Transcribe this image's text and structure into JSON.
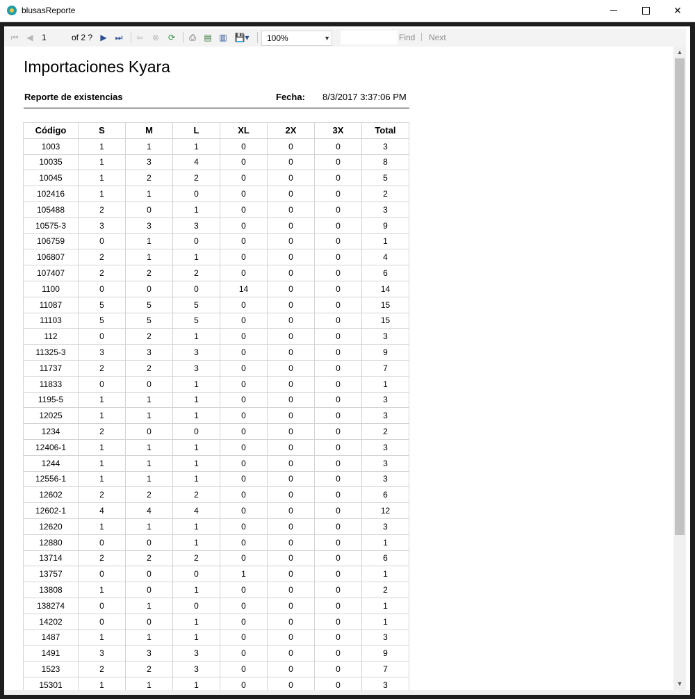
{
  "window": {
    "title": "blusasReporte",
    "minimize": "—",
    "maximize": "☐",
    "close": "✕"
  },
  "toolbar": {
    "page_value": "1",
    "page_of": "of  2 ?",
    "zoom": "100%",
    "find_placeholder": "",
    "find_label": "Find",
    "next_label": "Next",
    "icons": [
      "first-page",
      "previous-page",
      "next-page",
      "last-page",
      "back",
      "stop",
      "refresh",
      "print",
      "print-layout",
      "page-setup",
      "export"
    ]
  },
  "report": {
    "title": "Importaciones Kyara",
    "subtitle": "Reporte de existencias",
    "fecha_label": "Fecha:",
    "fecha": "8/3/2017 3:37:06 PM",
    "columns": [
      "Código",
      "S",
      "M",
      "L",
      "XL",
      "2X",
      "3X",
      "Total"
    ],
    "rows": [
      [
        "1003",
        "1",
        "1",
        "1",
        "0",
        "0",
        "0",
        "3"
      ],
      [
        "10035",
        "1",
        "3",
        "4",
        "0",
        "0",
        "0",
        "8"
      ],
      [
        "10045",
        "1",
        "2",
        "2",
        "0",
        "0",
        "0",
        "5"
      ],
      [
        "102416",
        "1",
        "1",
        "0",
        "0",
        "0",
        "0",
        "2"
      ],
      [
        "105488",
        "2",
        "0",
        "1",
        "0",
        "0",
        "0",
        "3"
      ],
      [
        "10575-3",
        "3",
        "3",
        "3",
        "0",
        "0",
        "0",
        "9"
      ],
      [
        "106759",
        "0",
        "1",
        "0",
        "0",
        "0",
        "0",
        "1"
      ],
      [
        "106807",
        "2",
        "1",
        "1",
        "0",
        "0",
        "0",
        "4"
      ],
      [
        "107407",
        "2",
        "2",
        "2",
        "0",
        "0",
        "0",
        "6"
      ],
      [
        "1100",
        "0",
        "0",
        "0",
        "14",
        "0",
        "0",
        "14"
      ],
      [
        "11087",
        "5",
        "5",
        "5",
        "0",
        "0",
        "0",
        "15"
      ],
      [
        "11103",
        "5",
        "5",
        "5",
        "0",
        "0",
        "0",
        "15"
      ],
      [
        "112",
        "0",
        "2",
        "1",
        "0",
        "0",
        "0",
        "3"
      ],
      [
        "11325-3",
        "3",
        "3",
        "3",
        "0",
        "0",
        "0",
        "9"
      ],
      [
        "11737",
        "2",
        "2",
        "3",
        "0",
        "0",
        "0",
        "7"
      ],
      [
        "11833",
        "0",
        "0",
        "1",
        "0",
        "0",
        "0",
        "1"
      ],
      [
        "1195-5",
        "1",
        "1",
        "1",
        "0",
        "0",
        "0",
        "3"
      ],
      [
        "12025",
        "1",
        "1",
        "1",
        "0",
        "0",
        "0",
        "3"
      ],
      [
        "1234",
        "2",
        "0",
        "0",
        "0",
        "0",
        "0",
        "2"
      ],
      [
        "12406-1",
        "1",
        "1",
        "1",
        "0",
        "0",
        "0",
        "3"
      ],
      [
        "1244",
        "1",
        "1",
        "1",
        "0",
        "0",
        "0",
        "3"
      ],
      [
        "12556-1",
        "1",
        "1",
        "1",
        "0",
        "0",
        "0",
        "3"
      ],
      [
        "12602",
        "2",
        "2",
        "2",
        "0",
        "0",
        "0",
        "6"
      ],
      [
        "12602-1",
        "4",
        "4",
        "4",
        "0",
        "0",
        "0",
        "12"
      ],
      [
        "12620",
        "1",
        "1",
        "1",
        "0",
        "0",
        "0",
        "3"
      ],
      [
        "12880",
        "0",
        "0",
        "1",
        "0",
        "0",
        "0",
        "1"
      ],
      [
        "13714",
        "2",
        "2",
        "2",
        "0",
        "0",
        "0",
        "6"
      ],
      [
        "13757",
        "0",
        "0",
        "0",
        "1",
        "0",
        "0",
        "1"
      ],
      [
        "13808",
        "1",
        "0",
        "1",
        "0",
        "0",
        "0",
        "2"
      ],
      [
        "138274",
        "0",
        "1",
        "0",
        "0",
        "0",
        "0",
        "1"
      ],
      [
        "14202",
        "0",
        "0",
        "1",
        "0",
        "0",
        "0",
        "1"
      ],
      [
        "1487",
        "1",
        "1",
        "1",
        "0",
        "0",
        "0",
        "3"
      ],
      [
        "1491",
        "3",
        "3",
        "3",
        "0",
        "0",
        "0",
        "9"
      ],
      [
        "1523",
        "2",
        "2",
        "3",
        "0",
        "0",
        "0",
        "7"
      ],
      [
        "15301",
        "1",
        "1",
        "1",
        "0",
        "0",
        "0",
        "3"
      ]
    ]
  }
}
